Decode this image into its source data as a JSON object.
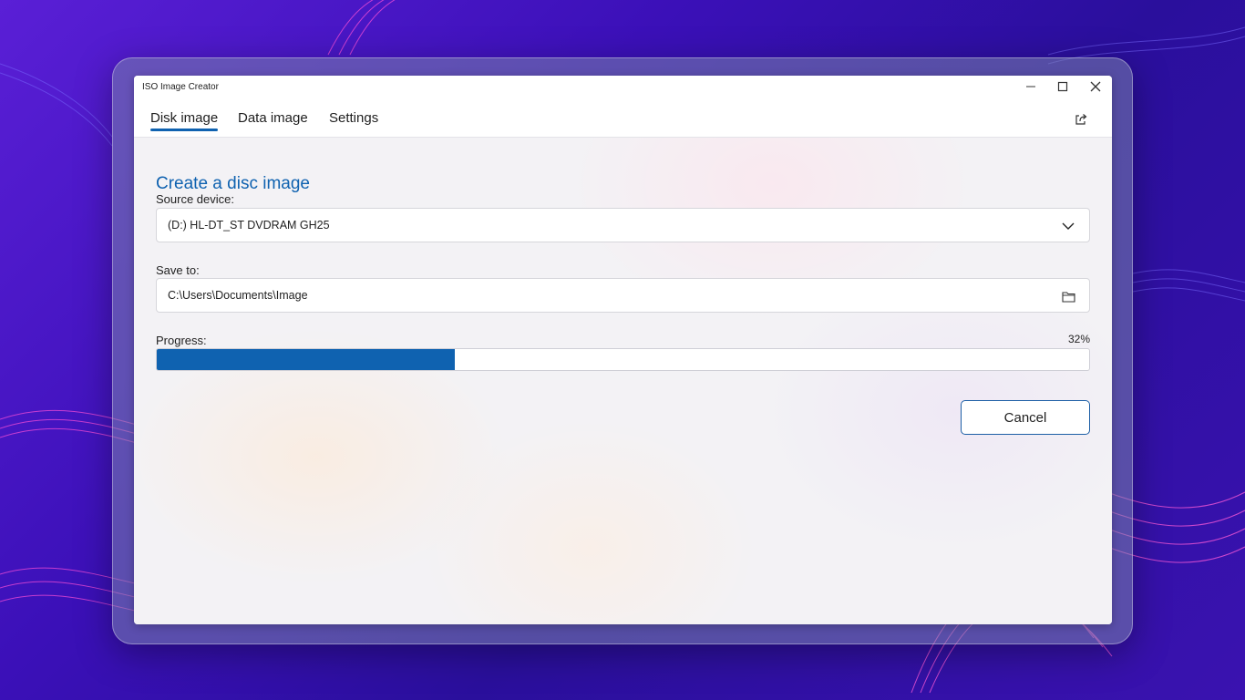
{
  "window": {
    "title": "ISO Image Creator",
    "controls": {
      "minimize": "minimize-icon",
      "maximize": "maximize-icon",
      "close": "close-icon"
    }
  },
  "tabs": [
    {
      "label": "Disk image",
      "active": true
    },
    {
      "label": "Data image",
      "active": false
    },
    {
      "label": "Settings",
      "active": false
    }
  ],
  "toolbar": {
    "share_icon": "share-icon"
  },
  "main": {
    "heading": "Create a disc image",
    "source": {
      "label": "Source device:",
      "value": "(D:) HL-DT_ST DVDRAM GH25",
      "icon": "chevron-down-icon"
    },
    "save_to": {
      "label": "Save to:",
      "value": "C:\\Users\\Documents\\Image",
      "icon": "folder-icon"
    },
    "progress": {
      "label": "Progress:",
      "percent_text": "32%",
      "value": 0.32
    },
    "cancel_label": "Cancel"
  },
  "colors": {
    "accent": "#0f62b0",
    "background": "#3b10b8"
  }
}
